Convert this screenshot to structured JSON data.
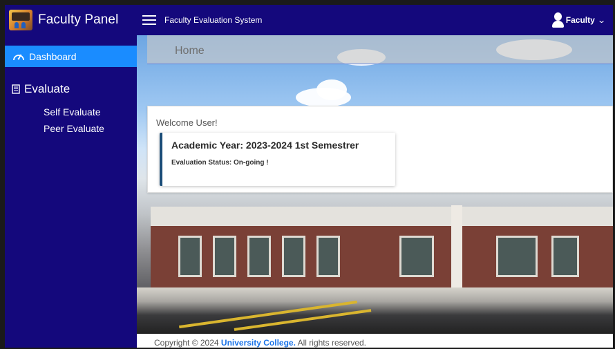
{
  "app": {
    "brand": "Faculty Panel",
    "system_title": "Faculty Evaluation System",
    "user": "Faculty"
  },
  "sidebar": {
    "active_item": {
      "label": "Dashboard",
      "icon": "gauge-icon"
    },
    "section": {
      "label": "Evaluate",
      "icon": "document-icon"
    },
    "items": [
      {
        "label": "Self Evaluate"
      },
      {
        "label": "Peer Evaluate"
      }
    ]
  },
  "main": {
    "page_title": "Home",
    "welcome": "Welcome User!",
    "academic_year": "Academic Year: 2023-2024 1st Semestrer",
    "evaluation_status": "Evaluation Status: On-going !"
  },
  "footer": {
    "prefix": "Copyright © 2024 ",
    "org": "University College.",
    "suffix": " All rights reserved."
  },
  "colors": {
    "navbar": "#14087c",
    "active": "#1a8cff",
    "link": "#1a73e8",
    "card_accent": "#1b4d78"
  }
}
